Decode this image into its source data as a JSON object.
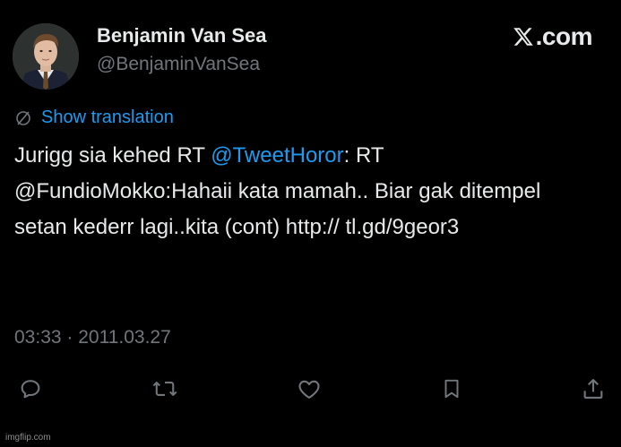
{
  "author": {
    "display_name": "Benjamin Van Sea",
    "handle": "@BenjaminVanSea"
  },
  "brand": {
    "logo_icon": "x-logo-icon",
    "suffix": ".com"
  },
  "translate": {
    "icon": "translate-icon",
    "label": "Show translation"
  },
  "tweet": {
    "text_before": "Jurigg sia kehed RT ",
    "mention": "@TweetHoror",
    "text_after": ": RT @FundioMokko:Hahaii kata mamah.. Biar gak ditempel setan kederr lagi..kita (cont) http:// tl.gd/9geor3"
  },
  "timestamp": "03:33 · 2011.03.27",
  "actions": [
    {
      "name": "reply",
      "icon": "reply-icon"
    },
    {
      "name": "retweet",
      "icon": "retweet-icon"
    },
    {
      "name": "like",
      "icon": "heart-icon"
    },
    {
      "name": "bookmark",
      "icon": "bookmark-icon"
    },
    {
      "name": "share",
      "icon": "share-icon"
    }
  ],
  "watermark": "imgflip.com",
  "colors": {
    "background": "#000000",
    "text": "#e7e9ea",
    "muted": "#71767b",
    "accent": "#1d9bf0"
  }
}
